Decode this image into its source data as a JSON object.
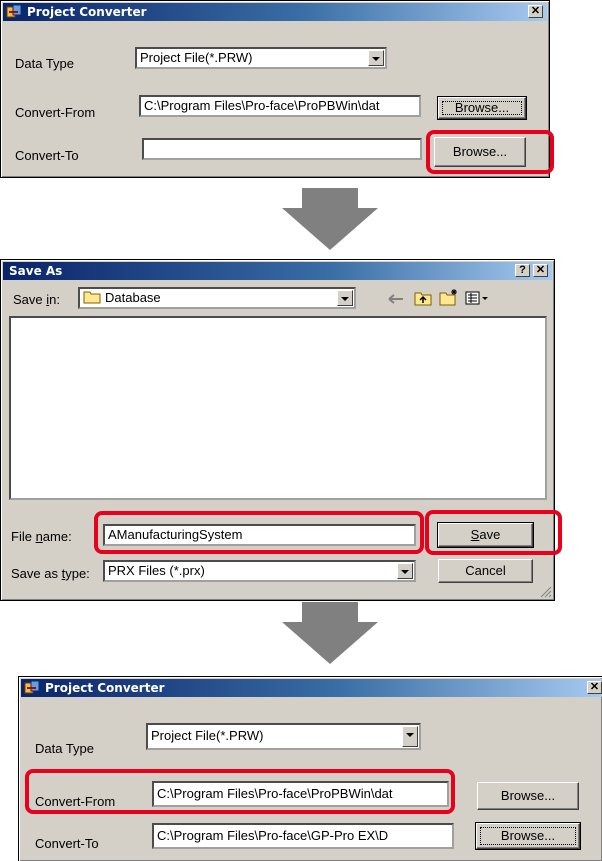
{
  "dialog1": {
    "title": "Project Converter",
    "close": "✕",
    "data_type_label": "Data Type",
    "data_type_value": "Project File(*.PRW)",
    "convert_from_label": "Convert-From",
    "convert_from_value": "C:\\Program Files\\Pro-face\\ProPBWin\\dat",
    "convert_to_label": "Convert-To",
    "convert_to_value": "",
    "browse1": "Browse...",
    "browse2": "Browse..."
  },
  "save_as": {
    "title": "Save As",
    "help": "?",
    "close": "✕",
    "save_in_pre": "Save ",
    "save_in_u": "i",
    "save_in_post": "n:",
    "save_in_value": "Database",
    "file_name_pre": "File ",
    "file_name_u": "n",
    "file_name_post": "ame:",
    "file_name_value": "AManufacturingSystem",
    "save_type_pre": "Save as ",
    "save_type_u": "t",
    "save_type_post": "ype:",
    "save_type_value": "PRX Files (*.prx)",
    "save_u": "S",
    "save_rest": "ave",
    "cancel": "Cancel"
  },
  "dialog2": {
    "title": "Project Converter",
    "close": "✕",
    "data_type_label": "Data Type",
    "data_type_value": "Project File(*.PRW)",
    "convert_from_label": "Convert-From",
    "convert_from_value": "C:\\Program Files\\Pro-face\\ProPBWin\\dat",
    "convert_to_label": "Convert-To",
    "convert_to_value": "C:\\Program Files\\Pro-face\\GP-Pro EX\\D",
    "browse1": "Browse...",
    "browse2": "Browse..."
  },
  "colors": {
    "highlight": "#e8001c",
    "arrow": "#808080",
    "dialog_bg": "#d4d0c8",
    "title_bar": "#0a246a"
  }
}
